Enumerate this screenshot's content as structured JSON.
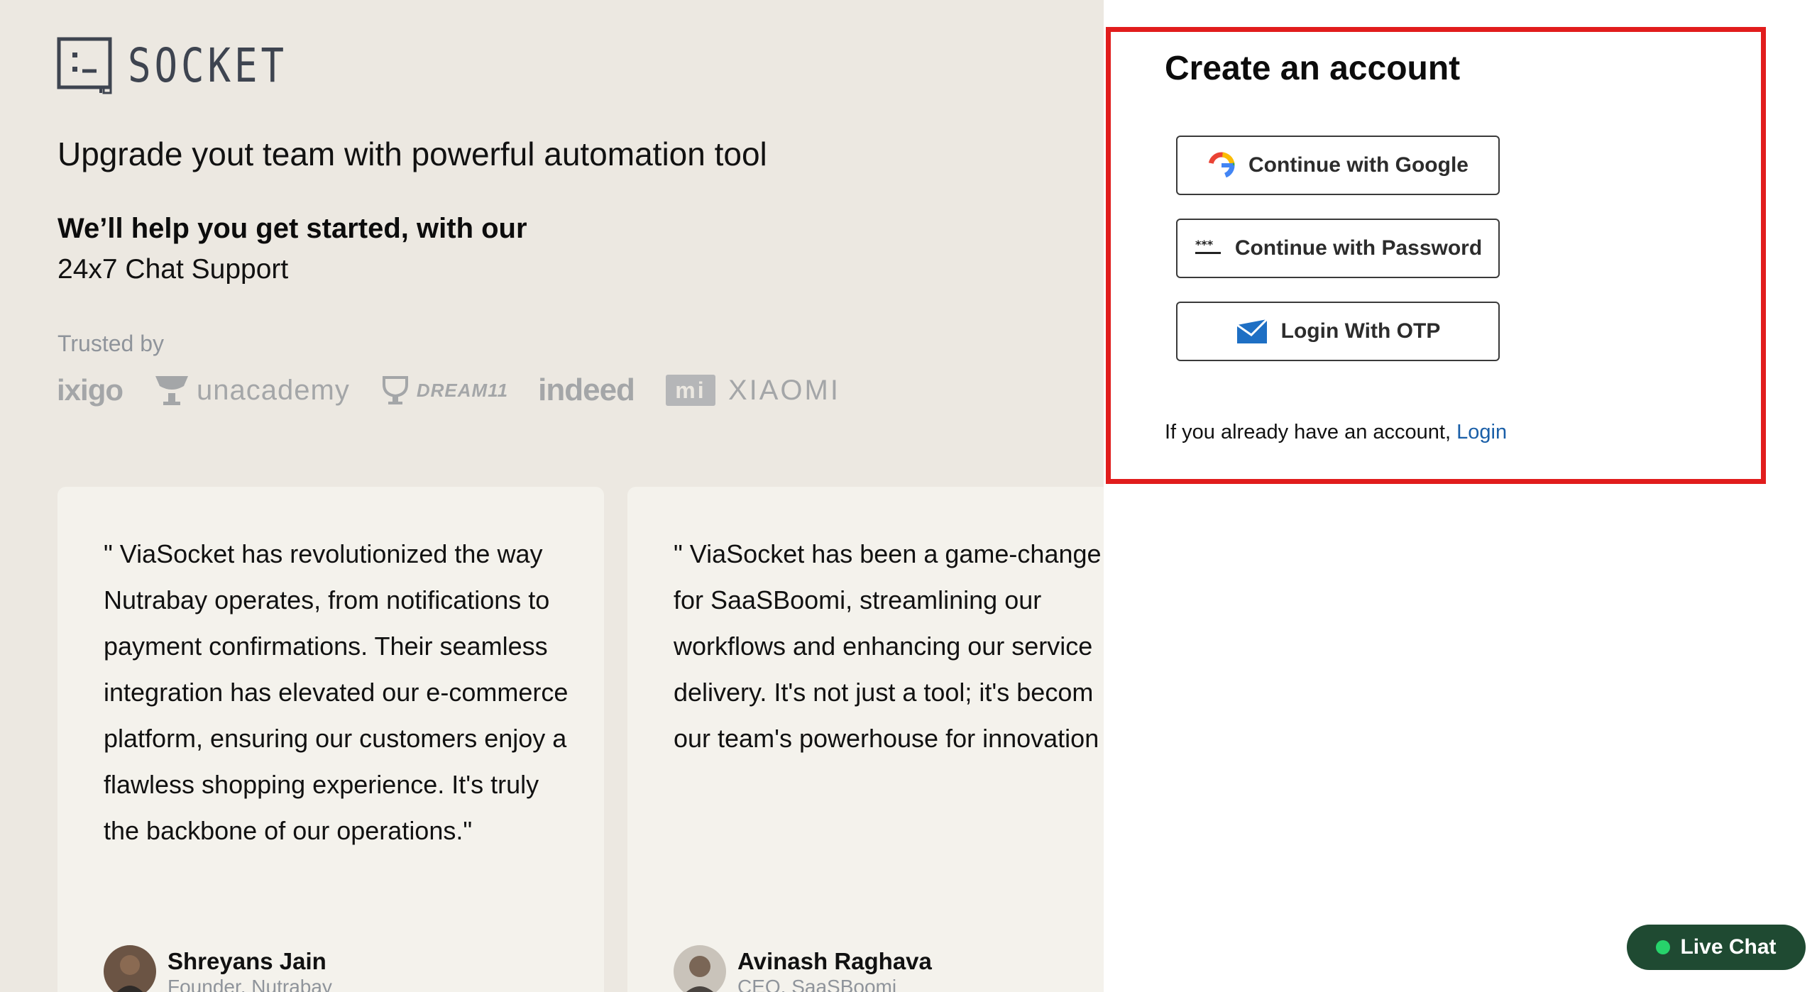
{
  "brand": {
    "logo_text": "SOCKET"
  },
  "hero": {
    "tagline": "Upgrade yout team with powerful automation tool",
    "help_heading": "We’ll help you get started, with our",
    "help_sub": "24x7 Chat Support"
  },
  "trusted": {
    "label": "Trusted by",
    "logos": [
      "ixigo",
      "unacademy",
      "DREAM11",
      "indeed",
      "mi",
      "XIAOMI"
    ]
  },
  "testimonials": [
    {
      "quote": "\" ViaSocket has revolutionized the way Nutrabay operates, from notifications to payment confirmations. Their seamless integration has elevated our e-commerce platform, ensuring our customers enjoy a flawless shopping experience. It's truly the backbone of our operations.\"",
      "name": "Shreyans Jain",
      "role": "Founder, Nutrabay"
    },
    {
      "quote": "\" ViaSocket has been a game-change\nfor SaaSBoomi, streamlining our\nworkflows and enhancing our service\ndelivery. It's not just a tool; it's becom\nour team's powerhouse for innovation",
      "name": "Avinash Raghava",
      "role": "CEO, SaaSBoomi"
    }
  ],
  "signup": {
    "title": "Create an account",
    "google_label": "Continue with Google",
    "password_label": "Continue with Password",
    "otp_label": "Login With OTP",
    "login_prompt": "If you already have an account,",
    "login_link": "Login"
  },
  "live_chat": {
    "label": "Live Chat"
  },
  "colors": {
    "left_background": "#ece8e1",
    "card_background": "#f4f2ec",
    "highlight_border": "#e11d1d",
    "link": "#1a5fa8",
    "live_chat_bg": "#1f4a32",
    "live_dot": "#27d36b"
  },
  "icons": [
    "socket-logo-icon",
    "google-icon",
    "password-dots-icon",
    "email-icon",
    "live-dot-icon"
  ]
}
